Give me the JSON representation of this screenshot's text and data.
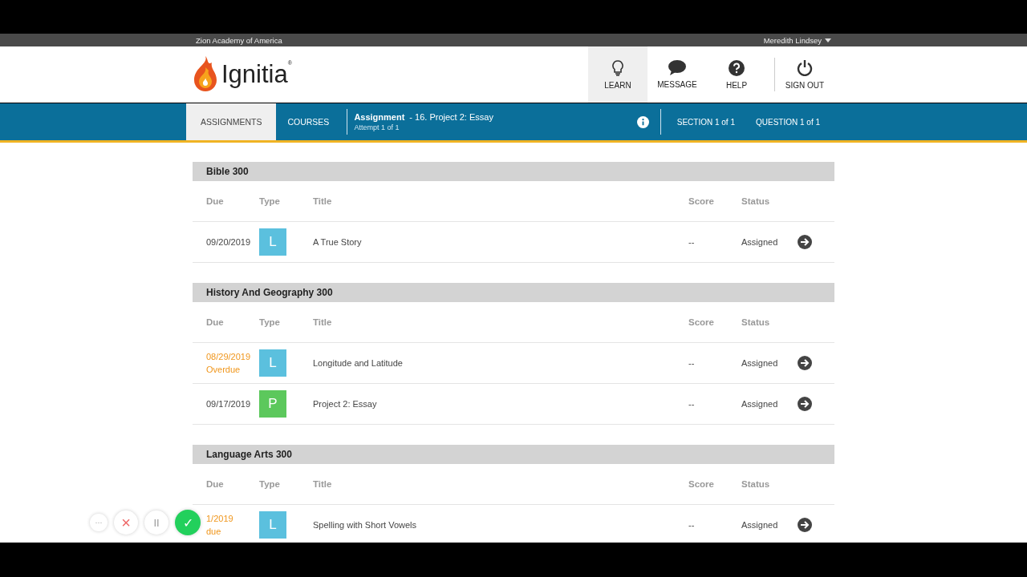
{
  "top_bar": {
    "school": "Zion Academy of America",
    "user": "Meredith Lindsey"
  },
  "logo": {
    "name": "Ignitia",
    "mark": "®"
  },
  "header_nav": [
    {
      "label": "LEARN",
      "kind": "learn",
      "selected": true
    },
    {
      "label": "MESSAGE",
      "kind": "message",
      "selected": false
    },
    {
      "label": "HELP",
      "kind": "help",
      "selected": false
    },
    {
      "label": "SIGN OUT",
      "kind": "signout",
      "selected": false
    }
  ],
  "tabs": [
    {
      "label": "ASSIGNMENTS",
      "selected": true
    },
    {
      "label": "COURSES",
      "selected": false
    }
  ],
  "assignment": {
    "label": "Assignment",
    "title": "- 16. Project 2: Essay",
    "attempt": "Attempt 1 of 1"
  },
  "progress": [
    {
      "label": "SECTION 1 of 1"
    },
    {
      "label": "QUESTION 1 of 1"
    }
  ],
  "courses": [
    {
      "name": "Bible 300",
      "columns": [
        "Due",
        "Type",
        "Title",
        "Score",
        "Status"
      ],
      "rows": [
        {
          "due": "09/20/2019",
          "overdue": false,
          "type": "L",
          "color": "#5bc0de",
          "title": "A True Story",
          "score": "--",
          "status": "Assigned"
        }
      ]
    },
    {
      "name": "History And Geography 300",
      "columns": [
        "Due",
        "Type",
        "Title",
        "Score",
        "Status"
      ],
      "rows": [
        {
          "due": "08/29/2019",
          "overdue": true,
          "overdue_label": "Overdue",
          "type": "L",
          "color": "#5bc0de",
          "title": "Longitude and Latitude",
          "score": "--",
          "status": "Assigned"
        },
        {
          "due": "09/17/2019",
          "overdue": false,
          "type": "P",
          "color": "#5cc85c",
          "title": "Project 2: Essay",
          "score": "--",
          "status": "Assigned"
        }
      ]
    },
    {
      "name": "Language Arts 300",
      "columns": [
        "Due",
        "Type",
        "Title",
        "Score",
        "Status"
      ],
      "rows": [
        {
          "due": "1/2019",
          "overdue": true,
          "overdue_label": "due",
          "type": "L",
          "color": "#5bc0de",
          "title": "Spelling with Short Vowels",
          "score": "--",
          "status": "Assigned"
        }
      ]
    }
  ],
  "recorder_toolbar": [
    {
      "kind": "more",
      "label": "···"
    },
    {
      "kind": "cancel",
      "label": "×"
    },
    {
      "kind": "pause",
      "label": "II"
    },
    {
      "kind": "done",
      "label": "✓"
    }
  ]
}
